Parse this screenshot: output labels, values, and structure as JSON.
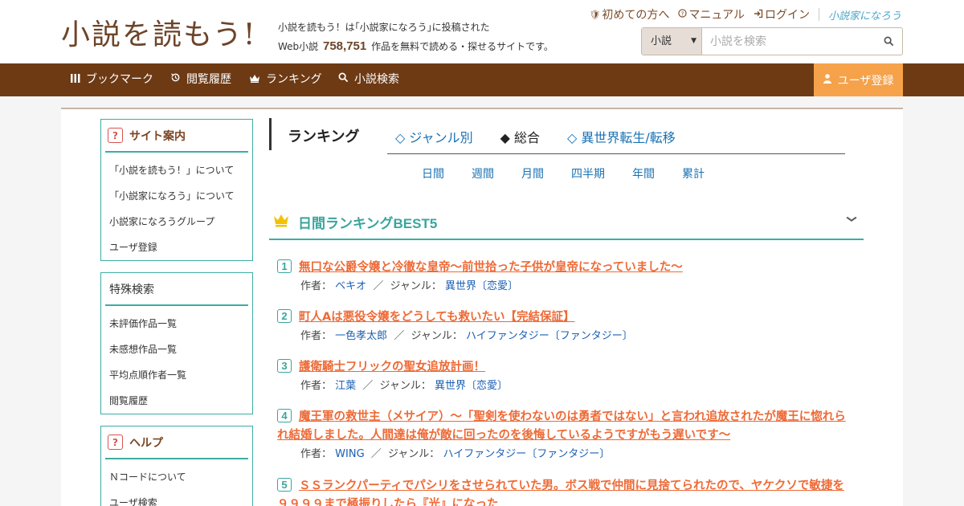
{
  "header": {
    "logo": "小説を読もう!",
    "tagline_line1": "小説を読もう！は｢小説家になろう｣に投稿された",
    "tagline_prefix": "Web小説",
    "novel_count": "758,751",
    "tagline_suffix": "作品を無料で読める・探せるサイトです。",
    "links": {
      "first_time": "初めての方へ",
      "manual": "マニュアル",
      "login": "ログイン",
      "narou": "小説家になろう"
    },
    "search": {
      "category": "小説",
      "placeholder": "小説を検索"
    }
  },
  "nav": {
    "bookmark": "ブックマーク",
    "history": "閲覧履歴",
    "ranking": "ランキング",
    "search": "小説検索",
    "register": "ユーザ登録"
  },
  "sidebar": {
    "site_guide": {
      "title": "サイト案内",
      "items": [
        "「小説を読もう！」について",
        "「小説家になろう」について",
        "小説家になろうグループ",
        "ユーザ登録"
      ]
    },
    "special_search": {
      "title": "特殊検索",
      "items": [
        "未評価作品一覧",
        "未感想作品一覧",
        "平均点順作者一覧",
        "閲覧履歴"
      ]
    },
    "help": {
      "title": "ヘルプ",
      "items": [
        "Ｎコードについて",
        "ユーザ検索"
      ]
    }
  },
  "ranking": {
    "title": "ランキング",
    "tabs": [
      "◇ ジャンル別",
      "◆ 総合",
      "◇ 異世界転生/転移"
    ],
    "periods": [
      "日間",
      "週間",
      "月間",
      "四半期",
      "年間",
      "累計"
    ],
    "best_title": "日間ランキングBEST5",
    "author_label": "作者：",
    "genre_label": "ジャンル：",
    "separator": "／",
    "entries": [
      {
        "rank": "1",
        "title": "無口な公爵令嬢と冷徹な皇帝～前世拾った子供が皇帝になっていました～",
        "author": "ベキオ",
        "genre": "異世界〔恋愛〕"
      },
      {
        "rank": "2",
        "title": "町人Aは悪役令嬢をどうしても救いたい【完結保証】",
        "author": "一色孝太郎",
        "genre": "ハイファンタジー〔ファンタジー〕"
      },
      {
        "rank": "3",
        "title": "護衛騎士フリックの聖女追放計画！",
        "author": "江葉",
        "genre": "異世界〔恋愛〕"
      },
      {
        "rank": "4",
        "title": "魔王軍の救世主（メサイア）～「聖剣を使わないのは勇者ではない」と言われ追放されたが魔王に惚れられ結婚しました。人間達は俺が敵に回ったのを後悔しているようですがもう遅いです～",
        "author": "WING",
        "genre": "ハイファンタジー〔ファンタジー〕"
      },
      {
        "rank": "5",
        "title": "ＳＳランクパーティでパシリをさせられていた男。ボス戦で仲間に見捨てられたので、ヤケクソで敏捷を９９９９まで極振りしたら『光』になった",
        "author": "",
        "genre": ""
      }
    ]
  }
}
